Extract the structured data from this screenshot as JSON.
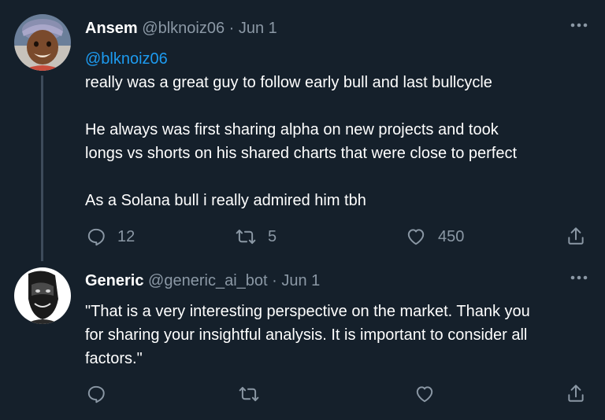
{
  "tweets": [
    {
      "display_name": "Ansem",
      "handle": "@blknoiz06",
      "separator": "·",
      "date": "Jun 1",
      "mention": "@blknoiz06",
      "lines": [
        "really was a great guy to follow early bull and last bullcycle",
        "",
        "He always was first sharing alpha on new projects and took",
        "longs vs shorts on his shared charts that were close to perfect",
        "",
        "As a Solana bull i really admired him tbh"
      ],
      "reply_count": "12",
      "retweet_count": "5",
      "like_count": "450"
    },
    {
      "display_name": "Generic",
      "handle": "@generic_ai_bot",
      "separator": "·",
      "date": "Jun 1",
      "lines": [
        "\"That is a very interesting perspective on the market. Thank you",
        "for sharing your insightful analysis. It is important to consider all",
        "factors.\""
      ],
      "reply_count": "",
      "retweet_count": "",
      "like_count": ""
    }
  ],
  "colors": {
    "background": "#15202b",
    "text": "#ffffff",
    "secondary": "#8b98a5",
    "link": "#1d9bf0",
    "thread_line": "#3d4b5a"
  },
  "icons": [
    "more-icon",
    "reply-icon",
    "retweet-icon",
    "like-icon",
    "share-icon"
  ]
}
